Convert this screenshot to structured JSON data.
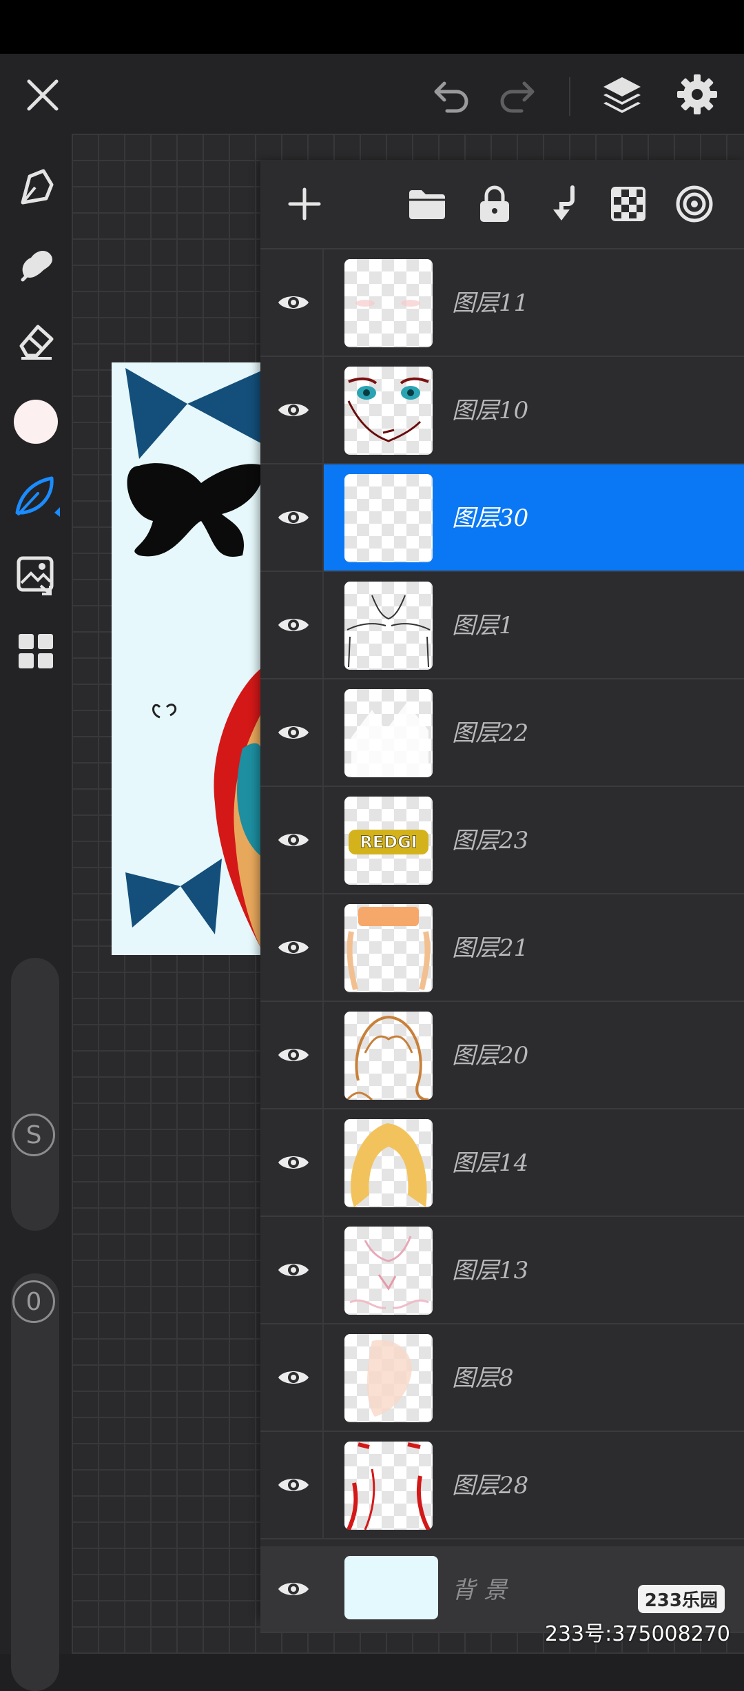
{
  "layers": [
    {
      "label": "图层11",
      "thumb": "faint"
    },
    {
      "label": "图层10",
      "thumb": "face"
    },
    {
      "label": "图层30",
      "thumb": "empty",
      "selected": true
    },
    {
      "label": "图层1",
      "thumb": "lines"
    },
    {
      "label": "图层22",
      "thumb": "white"
    },
    {
      "label": "图层23",
      "thumb": "text-logo"
    },
    {
      "label": "图层21",
      "thumb": "orange"
    },
    {
      "label": "图层20",
      "thumb": "hair-outline"
    },
    {
      "label": "图层14",
      "thumb": "hair-fill"
    },
    {
      "label": "图层13",
      "thumb": "pink-lines"
    },
    {
      "label": "图层8",
      "thumb": "skin"
    },
    {
      "label": "图层28",
      "thumb": "red-lines"
    }
  ],
  "background_layer": {
    "label": "背景"
  },
  "thumb_text": "REDGI",
  "brush": {
    "size_badge": "S",
    "opacity_badge": "0"
  },
  "watermark": {
    "logo": "233乐园",
    "id": "233号:375008270"
  },
  "colors": {
    "accent": "#0a78f5",
    "panel": "#2c2c2e",
    "current_color": "#fdf0f1"
  },
  "icons": [
    "close-icon",
    "undo-icon",
    "redo-icon",
    "layers-icon",
    "settings-icon",
    "pen-icon",
    "smudge-icon",
    "eraser-icon",
    "color-swatch",
    "ink-brush-icon",
    "image-import-icon",
    "grid-icon",
    "add-layer-icon",
    "folder-icon",
    "lock-icon",
    "merge-down-icon",
    "transparency-icon",
    "target-icon",
    "eye-icon"
  ]
}
